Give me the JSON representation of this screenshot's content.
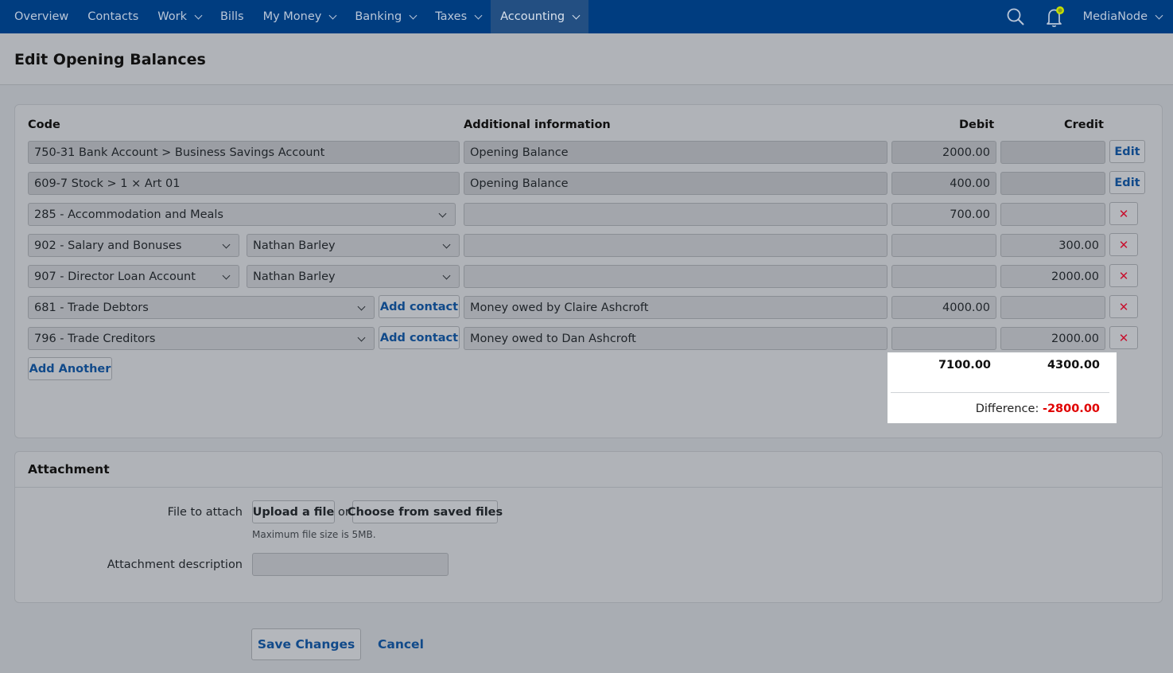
{
  "nav": {
    "items": [
      {
        "label": "Overview",
        "chevron": false,
        "active": false
      },
      {
        "label": "Contacts",
        "chevron": false,
        "active": false
      },
      {
        "label": "Work",
        "chevron": true,
        "active": false
      },
      {
        "label": "Bills",
        "chevron": false,
        "active": false
      },
      {
        "label": "My Money",
        "chevron": true,
        "active": false
      },
      {
        "label": "Banking",
        "chevron": true,
        "active": false
      },
      {
        "label": "Taxes",
        "chevron": true,
        "active": false
      },
      {
        "label": "Accounting",
        "chevron": true,
        "active": true
      }
    ],
    "user": "MediaNode",
    "icons": [
      "search-icon",
      "bell-icon"
    ],
    "colors": {
      "bar": "#003d80",
      "active": "#234f82",
      "badge": "#c5e000"
    }
  },
  "page": {
    "title": "Edit Opening Balances"
  },
  "table": {
    "headers": {
      "code": "Code",
      "info": "Additional information",
      "debit": "Debit",
      "credit": "Credit"
    },
    "rows": [
      {
        "code": "750-31 Bank Account  >  Business Savings Account",
        "info": "Opening Balance",
        "debit": "2000.00",
        "credit": "",
        "action": "Edit"
      },
      {
        "code": "609-7 Stock  >  1 × Art 01",
        "info": "Opening Balance",
        "debit": "400.00",
        "credit": "",
        "action": "Edit"
      },
      {
        "code": "285 - Accommodation and Meals",
        "info": "",
        "debit": "700.00",
        "credit": "",
        "action": "✕"
      },
      {
        "code": "902 - Salary and Bonuses",
        "contact": "Nathan Barley",
        "info": "",
        "debit": "",
        "credit": "300.00",
        "action": "✕"
      },
      {
        "code": "907 - Director Loan Account",
        "contact": "Nathan Barley",
        "info": "",
        "debit": "",
        "credit": "2000.00",
        "action": "✕"
      },
      {
        "code": "681 - Trade Debtors",
        "add_contact": "Add contact",
        "info": "Money owed by Claire Ashcroft",
        "debit": "4000.00",
        "credit": "",
        "action": "✕"
      },
      {
        "code": "796 - Trade Creditors",
        "add_contact": "Add contact",
        "info": "Money owed to Dan Ashcroft",
        "debit": "",
        "credit": "2000.00",
        "action": "✕"
      }
    ],
    "add_another": "Add Another",
    "totals": {
      "debit": "7100.00",
      "credit": "4300.00",
      "difference_label": "Difference:",
      "difference": "-2800.00"
    }
  },
  "attachment": {
    "title": "Attachment",
    "file_label": "File to attach",
    "upload": "Upload a file",
    "or": "or",
    "choose": "Choose from saved files",
    "hint": "Maximum file size is 5MB.",
    "desc_label": "Attachment description",
    "desc_value": ""
  },
  "footer": {
    "save": "Save Changes",
    "cancel": "Cancel"
  }
}
